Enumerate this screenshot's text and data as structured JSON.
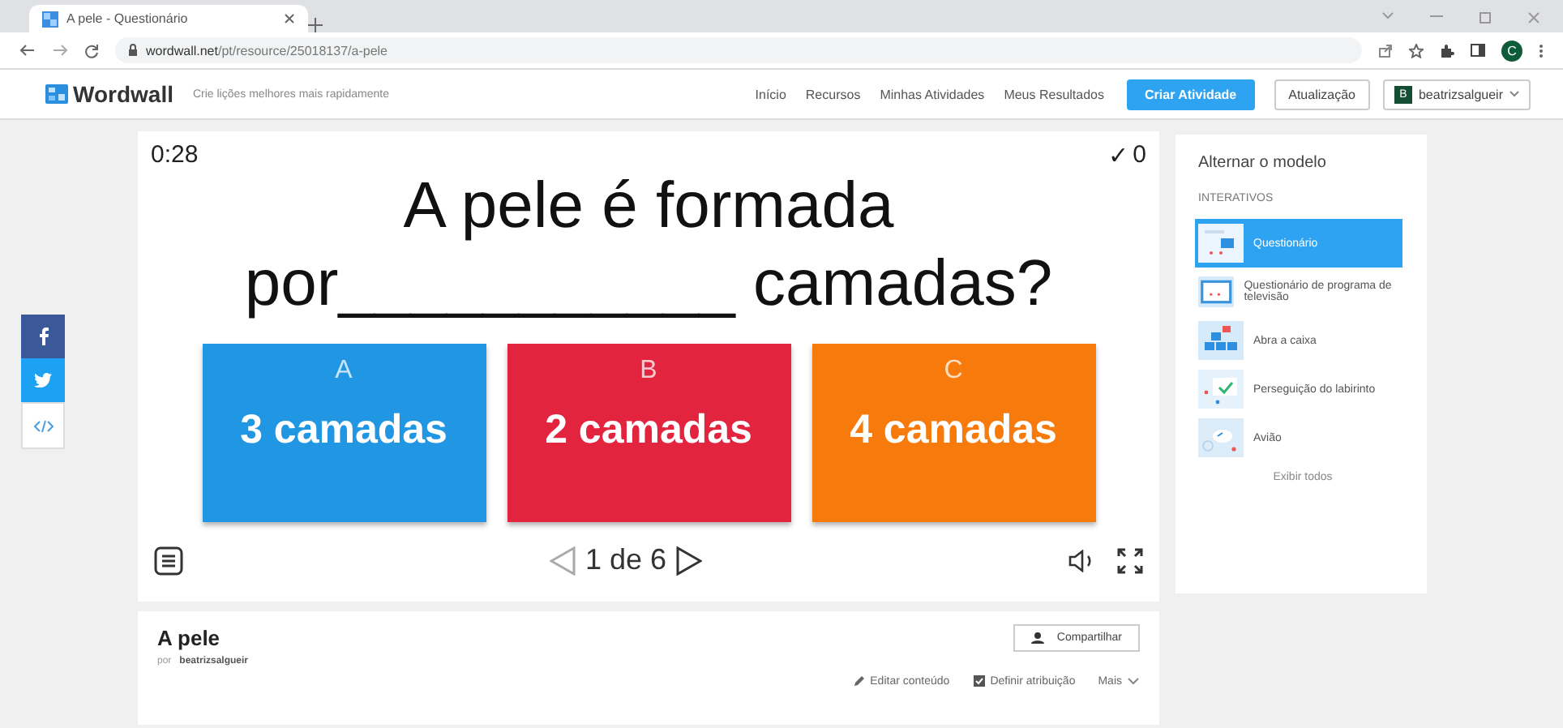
{
  "browser": {
    "tab_title": "A pele - Questionário",
    "url_host": "wordwall.net",
    "url_path": "/pt/resource/25018137/a-pele",
    "profile_initial": "C"
  },
  "header": {
    "logo": "Wordwall",
    "tagline": "Crie lições melhores mais rapidamente",
    "nav": [
      "Início",
      "Recursos",
      "Minhas Atividades",
      "Meus Resultados"
    ],
    "create_button": "Criar Atividade",
    "upgrade_button": "Atualização",
    "user_initial": "B",
    "user": "beatrizsalgueir"
  },
  "game": {
    "timer": "0:28",
    "score_mark": "✓",
    "score": "0",
    "question_line1": "A pele é formada",
    "question_line2": "por___________ camadas?",
    "options": [
      {
        "letter": "A",
        "text": "3 camadas",
        "color": "#2196e3"
      },
      {
        "letter": "B",
        "text": "2 camadas",
        "color": "#e3243f"
      },
      {
        "letter": "C",
        "text": "4 camadas",
        "color": "#f77b0c"
      }
    ],
    "pagination": "1 de 6"
  },
  "templates": {
    "title": "Alternar o modelo",
    "section": "INTERATIVOS",
    "items": [
      {
        "label": "Questionário",
        "selected": true
      },
      {
        "label": "Questionário de programa de televisão",
        "selected": false
      },
      {
        "label": "Abra a caixa",
        "selected": false
      },
      {
        "label": "Perseguição do labirinto",
        "selected": false
      },
      {
        "label": "Avião",
        "selected": false
      }
    ],
    "show_all": "Exibir todos"
  },
  "info": {
    "title": "A pele",
    "author_prefix": "por",
    "author": "beatrizsalgueir",
    "share_button": "Compartilhar",
    "actions": [
      "Editar conteúdo",
      "Definir atribuição",
      "Mais"
    ]
  }
}
